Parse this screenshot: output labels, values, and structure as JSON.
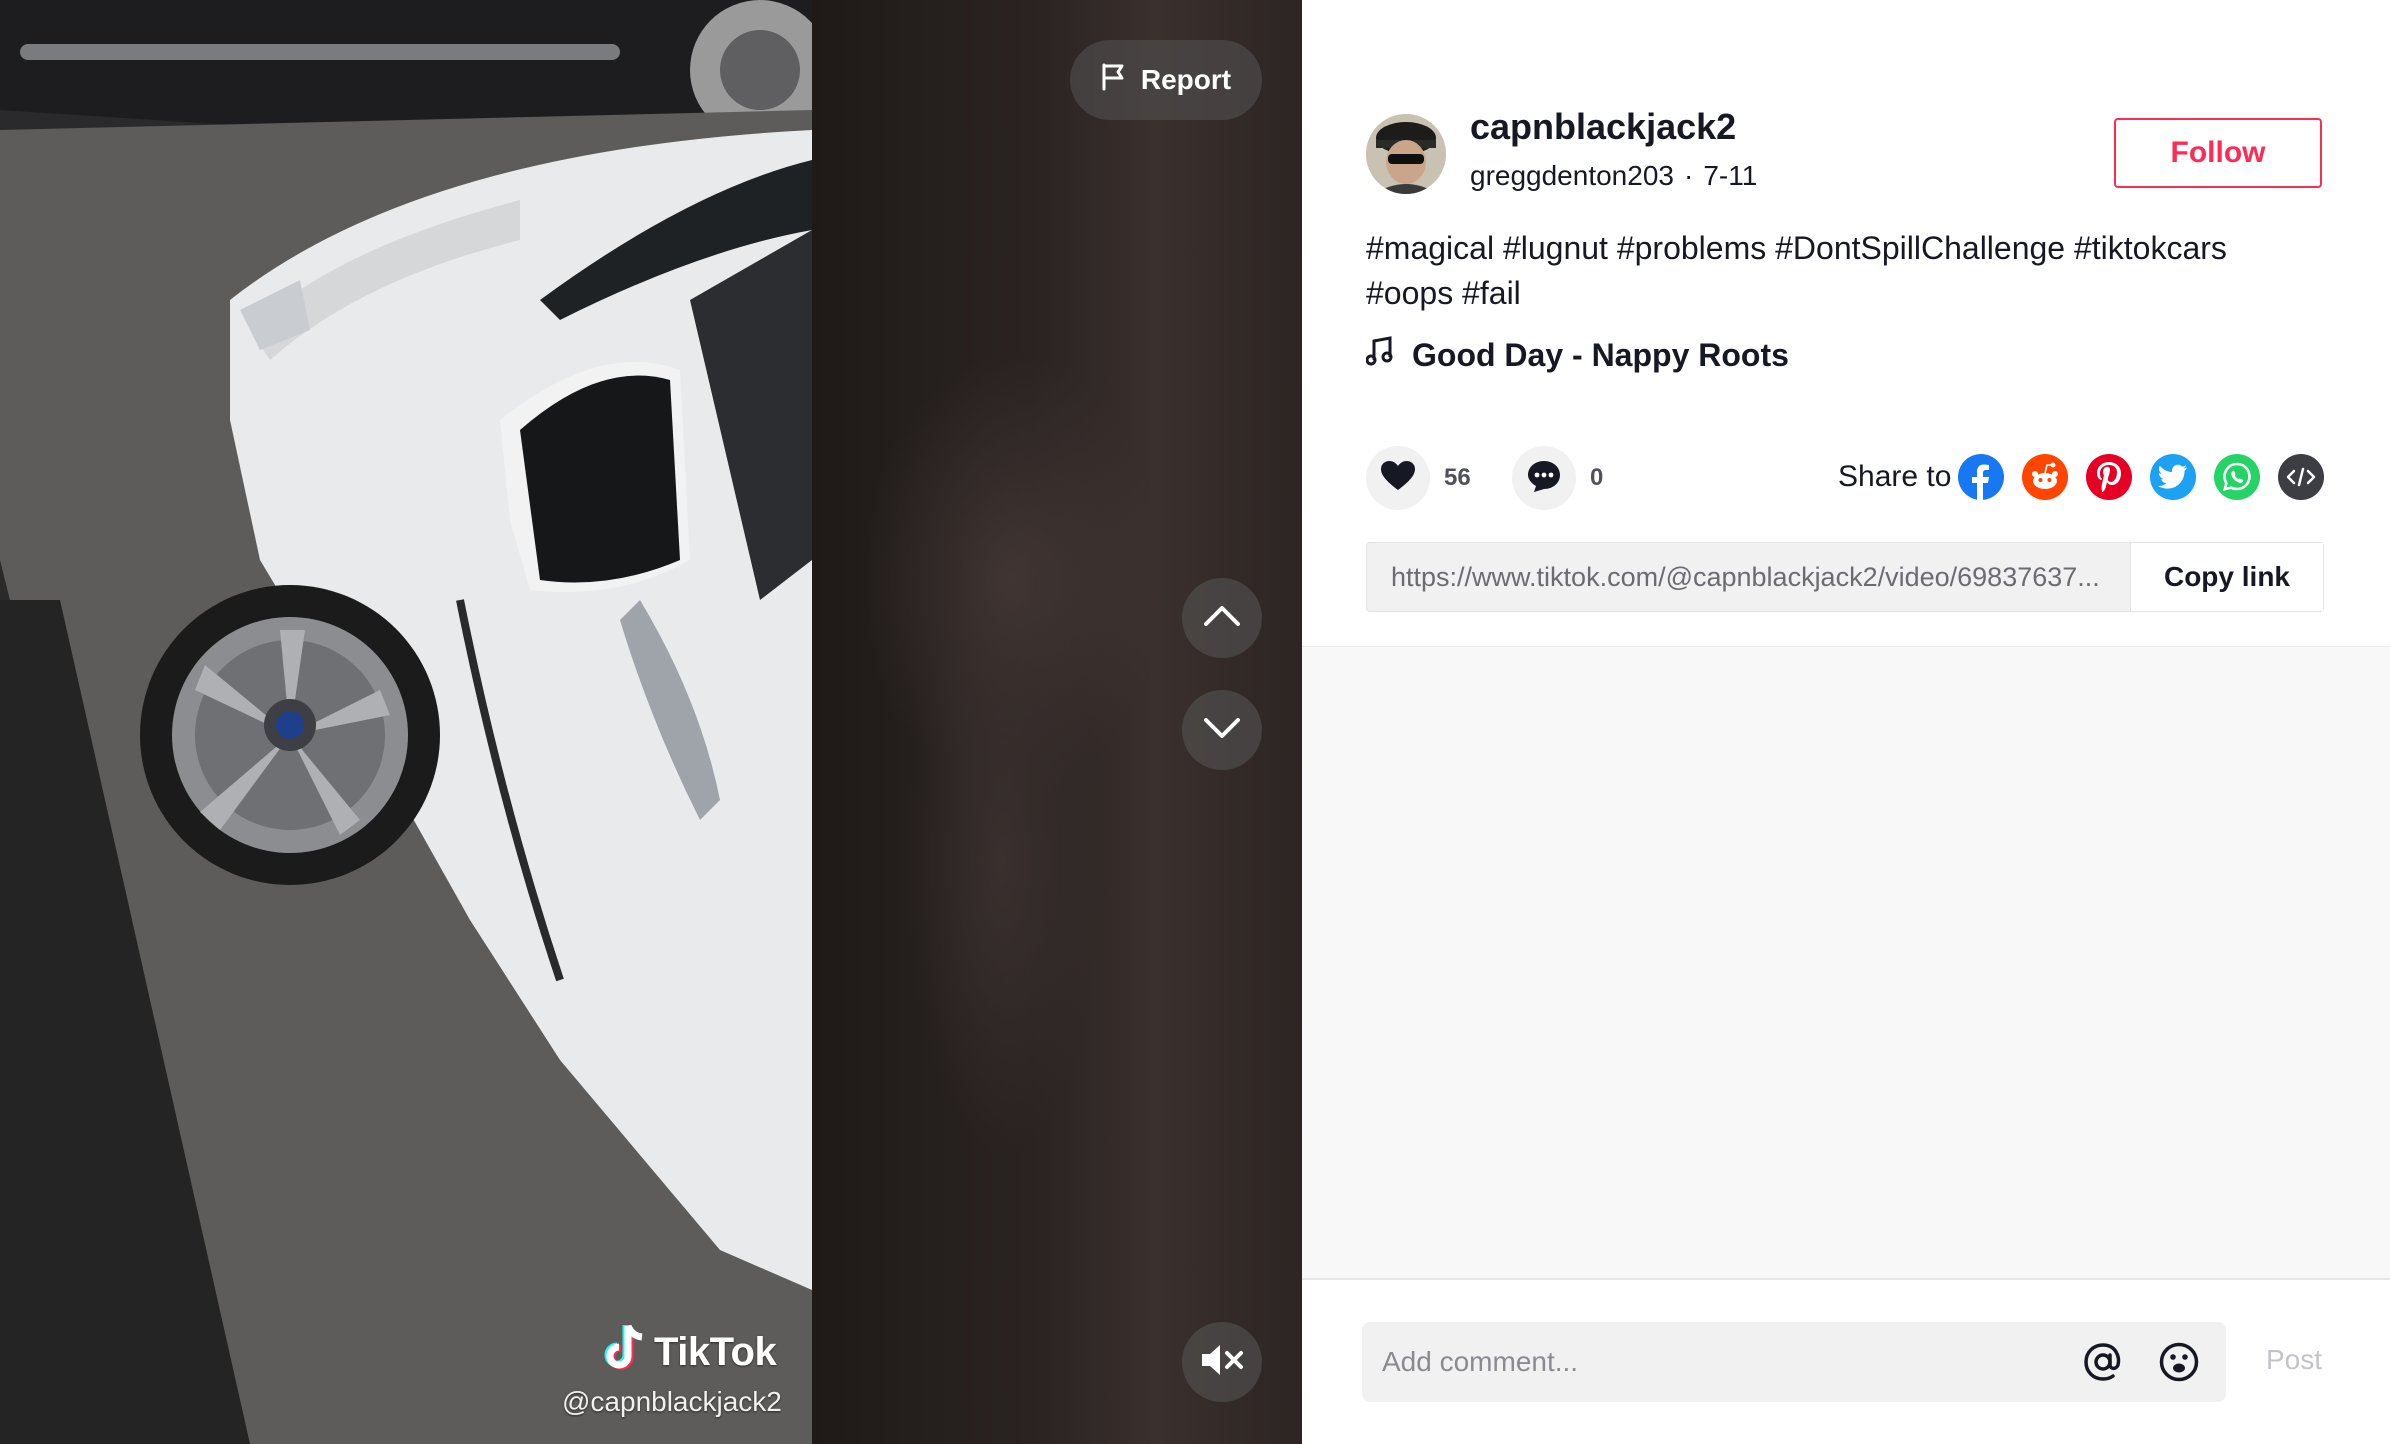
{
  "video": {
    "report_label": "Report",
    "watermark_brand": "TikTok",
    "watermark_handle": "@capnblackjack2"
  },
  "author": {
    "username": "capnblackjack2",
    "nickname": "greggdenton203",
    "separator": "·",
    "date": "7-11",
    "follow_label": "Follow"
  },
  "post": {
    "caption_line1": "#magical #lugnut #problems #DontSpillChallenge #tiktokcars",
    "caption_line2": "#oops #fail",
    "music": "Good Day - Nappy Roots"
  },
  "stats": {
    "likes": "56",
    "comments": "0"
  },
  "share": {
    "label": "Share to",
    "targets": [
      "facebook-icon",
      "reddit-icon",
      "pinterest-icon",
      "twitter-icon",
      "whatsapp-icon",
      "embed-icon"
    ],
    "link": "https://www.tiktok.com/@capnblackjack2/video/69837637...",
    "copy_label": "Copy link"
  },
  "comment_box": {
    "placeholder": "Add comment...",
    "post_label": "Post"
  },
  "colors": {
    "accent": "#fe2c55",
    "facebook": "#1877f2",
    "reddit": "#ff4500",
    "pinterest": "#e60023",
    "twitter": "#1da1f2",
    "whatsapp": "#25d366",
    "embed": "#3d3d44"
  }
}
